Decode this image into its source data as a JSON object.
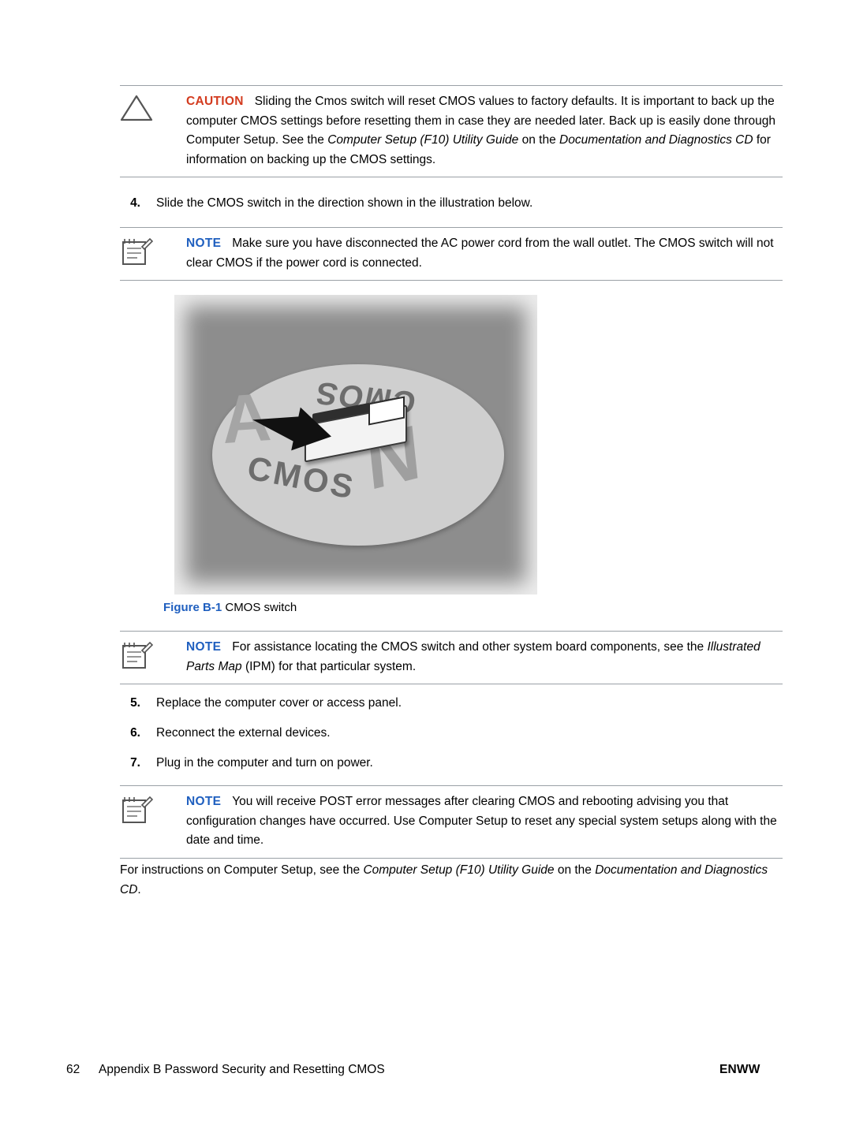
{
  "document": {
    "caution": {
      "label": "CAUTION",
      "icon": "caution-triangle-icon",
      "text_parts": [
        {
          "t": "Sliding the Cmos switch will reset CMOS values to factory defaults. It is important to back up the computer CMOS settings before resetting them in case they are needed later. Back up is easily done through Computer Setup. See the ",
          "style": "normal"
        },
        {
          "t": "Computer Setup (F10) Utility Guide",
          "style": "italic"
        },
        {
          "t": " on the ",
          "style": "normal"
        },
        {
          "t": "Documentation and Diagnostics CD",
          "style": "italic"
        },
        {
          "t": " for information on backing up the CMOS settings.",
          "style": "normal"
        }
      ]
    },
    "step4": {
      "number": "4.",
      "text": "Slide the CMOS switch in the direction shown in the illustration below."
    },
    "note1": {
      "label": "NOTE",
      "icon": "note-pad-icon",
      "text": "Make sure you have disconnected the AC power cord from the wall outlet. The CMOS switch will not clear CMOS if the power cord is connected."
    },
    "figure": {
      "caption_label": "Figure B-1",
      "caption_text": "CMOS switch",
      "labels": {
        "top": "CMOS",
        "bottom": "CMOS",
        "letter_n": "N",
        "letter_a": "A"
      }
    },
    "note2": {
      "label": "NOTE",
      "icon": "note-pad-icon",
      "text_parts": [
        {
          "t": "For assistance locating the CMOS switch and other system board components, see the ",
          "style": "normal"
        },
        {
          "t": "Illustrated Parts Map",
          "style": "italic"
        },
        {
          "t": " (IPM) for that particular system.",
          "style": "normal"
        }
      ]
    },
    "step5": {
      "number": "5.",
      "text": "Replace the computer cover or access panel."
    },
    "step6": {
      "number": "6.",
      "text": "Reconnect the external devices."
    },
    "step7": {
      "number": "7.",
      "text": "Plug in the computer and turn on power."
    },
    "note3": {
      "label": "NOTE",
      "icon": "note-pad-icon",
      "text": "You will receive POST error messages after clearing CMOS and rebooting advising you that configuration changes have occurred. Use Computer Setup to reset any special system setups along with the date and time."
    },
    "trailing": {
      "parts": [
        {
          "t": "For instructions on Computer Setup, see the ",
          "style": "normal"
        },
        {
          "t": "Computer Setup (F10) Utility Guide",
          "style": "italic"
        },
        {
          "t": " on the ",
          "style": "normal"
        },
        {
          "t": "Documentation and Diagnostics CD",
          "style": "italic"
        },
        {
          "t": ".",
          "style": "normal"
        }
      ]
    },
    "footer": {
      "page_number": "62",
      "title": "Appendix B   Password Security and Resetting CMOS",
      "right": "ENWW"
    },
    "colors": {
      "caution_label": "#d33b1f",
      "note_label": "#1f5fbf",
      "rule": "#9aa0a6"
    }
  }
}
